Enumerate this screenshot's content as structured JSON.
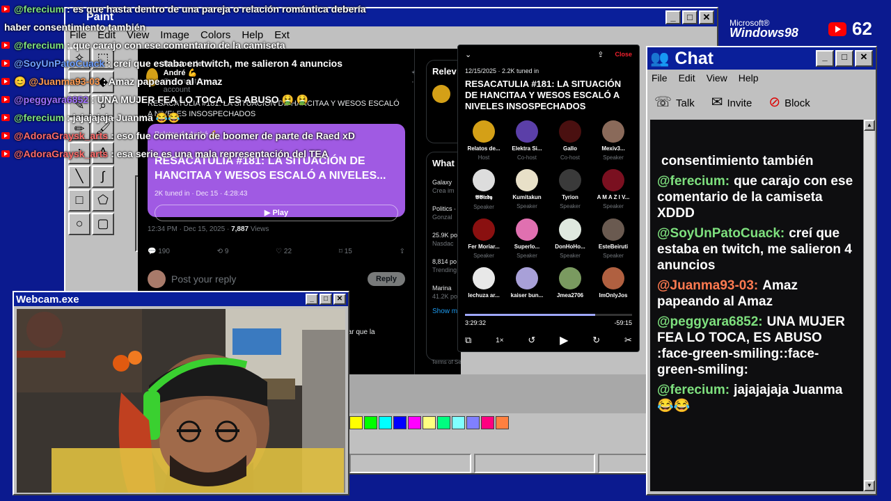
{
  "paint": {
    "title": "Paint",
    "menus": [
      "File",
      "Edit",
      "View",
      "Image",
      "Colors",
      "Help",
      "Ext"
    ],
    "palette": [
      "#ffff00",
      "#00ff00",
      "#00ffff",
      "#0000ff",
      "#ff00ff",
      "#ffff80",
      "#00ff80",
      "#80ffff",
      "#8080ff",
      "#ff0080",
      "#ff8040"
    ]
  },
  "tweet": {
    "author": "Relatos de André 💪",
    "commentary": "Commentary account",
    "body": "RESACATULIA #181: LA SITUACIÓN DE HANCITAA Y WESOS ESCALÓ A NIVELES INSOSPECHADOS",
    "card_author": "Relatos de André 💪",
    "card_title": "RESACATULIA #181: LA SITUACIÓN DE HANCITAA Y WESOS ESCALÓ A NIVELES...",
    "card_meta": "2K tuned in · Dec 15 · 4:28:43",
    "play_label": "▶ Play",
    "timestamp": "12:34 PM · Dec 15, 2025 · ",
    "views": "7,887",
    "views_label": " Views",
    "replies": "190",
    "reposts": "9",
    "likes": "22",
    "bookmarks": "15",
    "reply_placeholder": "Post your reply",
    "reply_button": "Reply",
    "snippet": "e dejar que la"
  },
  "sidebar": {
    "relevant": "Relev",
    "what": "What",
    "trends": [
      {
        "label": "Galaxy",
        "sub": "Crea im"
      },
      {
        "label": "Politics ·",
        "sub": "Gonzal"
      },
      {
        "label": "25.9K po",
        "sub": "Nasdac"
      },
      {
        "label": "8,814 po",
        "sub": "Trending"
      },
      {
        "label": "Marina",
        "sub": "41.2K po"
      }
    ],
    "show_more": "Show m",
    "footer": "Terms of Service   Privacy Policy   Cookie Policy"
  },
  "space": {
    "close": "Close",
    "meta": "12/15/2025 · 2.2K tuned in",
    "title": "RESACATULIA #181: LA SITUACIÓN DE HANCITAA Y WESOS ESCALÓ A NIVELES INSOSPECHADOS",
    "elapsed": "3:29:32",
    "remaining": "-59:15",
    "progress": 0.78,
    "speed": "1×",
    "speakers": [
      {
        "name": "Relatos de...",
        "role": "Host",
        "color": "#d4a017"
      },
      {
        "name": "Elektra Si...",
        "role": "Co-host",
        "color": "#5b3fa8"
      },
      {
        "name": "Gallo",
        "role": "Co-host",
        "color": "#4a1010"
      },
      {
        "name": "Mexiv3...",
        "role": "Speaker",
        "color": "#8a6a5a"
      },
      {
        "name": "𝕭𝕭𝖎𝖗𝖉𝖞",
        "role": "Speaker",
        "color": "#dddddd"
      },
      {
        "name": "Kumitakun",
        "role": "Speaker",
        "color": "#e8e0c8"
      },
      {
        "name": "Tyrion",
        "role": "Speaker",
        "color": "#3a3a3a"
      },
      {
        "name": "A M A Z I V...",
        "role": "Speaker",
        "color": "#7a1020"
      },
      {
        "name": "Fer Moriar...",
        "role": "Speaker",
        "color": "#8a1010"
      },
      {
        "name": "Superlo...",
        "role": "Speaker",
        "color": "#e070b0"
      },
      {
        "name": "DonHoHo...",
        "role": "Speaker",
        "color": "#dfe8df"
      },
      {
        "name": "EsteBeiruti",
        "role": "Speaker",
        "color": "#6a5a50"
      },
      {
        "name": "lechuza ar...",
        "role": "",
        "color": "#e8e8e8"
      },
      {
        "name": "kaiser bun...",
        "role": "",
        "color": "#a8a0d8"
      },
      {
        "name": "Jmea2706",
        "role": "",
        "color": "#7a9a60"
      },
      {
        "name": "ImOnlyJos",
        "role": "",
        "color": "#b06040"
      }
    ]
  },
  "chat": {
    "title": "Chat",
    "menus": [
      "File",
      "Edit",
      "View",
      "Help"
    ],
    "tools": [
      {
        "icon": "☏",
        "label": "Talk"
      },
      {
        "icon": "✉",
        "label": "Invite"
      },
      {
        "icon": "⊘",
        "label": "Block"
      }
    ],
    "messages": [
      {
        "user": "",
        "text": "consentimiento también",
        "color": "#ffffff"
      },
      {
        "user": "@ferecium:",
        "text": "que carajo con ese comentario de la camiseta XDDD",
        "color": "#7ee07e"
      },
      {
        "user": "@SoyUnPatoCuack:",
        "text": "creí que estaba en twitch, me salieron 4 anuncios",
        "color": "#7ee07e"
      },
      {
        "user": "@Juanma93-03:",
        "text": "Amaz papeando al Amaz",
        "color": "#ff7a50"
      },
      {
        "user": "@peggyara6852:",
        "text": "UNA MUJER FEA LO TOCA, ES ABUSO :face-green-smiling::face-green-smiling:",
        "color": "#7ee07e"
      },
      {
        "user": "@ferecium:",
        "text": "jajajajaja Juanma 😂😂",
        "color": "#7ee07e"
      }
    ]
  },
  "windows": {
    "ms": "Microsoft®",
    "name": "Windows98"
  },
  "viewers": "62",
  "overlay": [
    {
      "user": "@ferecium",
      "text": ": es que hasta dentro de una pareja o relación romántica debería",
      "color": "#7ee07e"
    },
    {
      "user": "",
      "text": "haber consentimiento también",
      "color": "#ffffff"
    },
    {
      "user": "@ferecium",
      "text": ": que carajo con ese comentario de la camiseta",
      "color": "#7ee07e"
    },
    {
      "user": "@SoyUnPatoCuack",
      "text": ": creí que estaba en twitch, me salieron 4 anuncios",
      "color": "#6fa0ff"
    },
    {
      "user": "😊 @Juanma93-03",
      "text": ": Amaz papeando al Amaz",
      "color": "#ff9a50"
    },
    {
      "user": "@peggyara6852",
      "text": ": UNA MUJER FEA LO TOCA, ES ABUSO 🤮 🤮",
      "color": "#a070ff"
    },
    {
      "user": "@ferecium",
      "text": ": jajajajaja Juanma 😂😂",
      "color": "#7ee07e"
    },
    {
      "user": "@AdoraGraysk_arts",
      "text": ": eso fue comentario de boomer de parte de Raed xD",
      "color": "#ff6a6a"
    },
    {
      "user": "@AdoraGraysk_arts",
      "text": ": esa serie es una mala representación del TEA",
      "color": "#ff6a6a"
    }
  ],
  "webcam": {
    "title": "Webcam.exe"
  }
}
